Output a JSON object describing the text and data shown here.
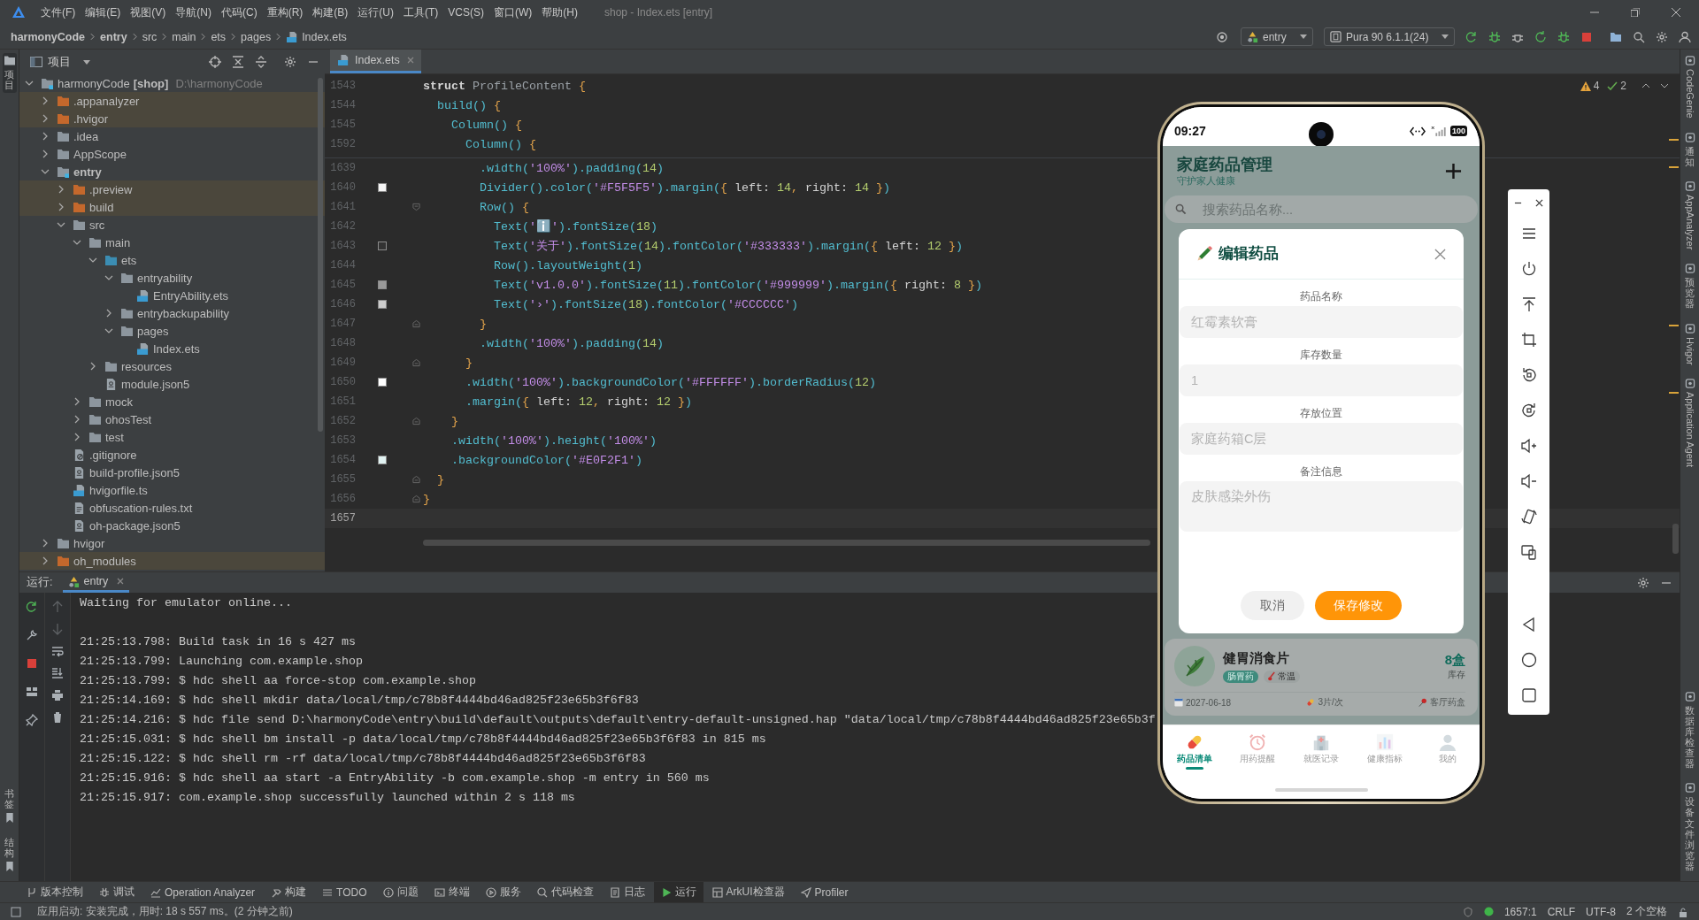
{
  "menu_bar": {
    "items": [
      "文件(F)",
      "编辑(E)",
      "视图(V)",
      "导航(N)",
      "代码(C)",
      "重构(R)",
      "构建(B)",
      "运行(U)",
      "工具(T)",
      "VCS(S)",
      "窗口(W)",
      "帮助(H)"
    ],
    "title": "shop - Index.ets [entry]"
  },
  "nav_bar": {
    "breadcrumb": [
      {
        "label": "harmonyCode",
        "kind": "project"
      },
      {
        "label": "entry",
        "kind": "module"
      },
      {
        "label": "src",
        "kind": "folder"
      },
      {
        "label": "main",
        "kind": "folder"
      },
      {
        "label": "ets",
        "kind": "folder"
      },
      {
        "label": "pages",
        "kind": "folder"
      },
      {
        "label": "Index.ets",
        "kind": "file"
      }
    ],
    "module": "entry",
    "device": "Pura 90 6.1.1(24)"
  },
  "left_strip": {
    "top": [
      {
        "label": "项目",
        "selected": true
      }
    ],
    "bottom": [
      {
        "label": "书签",
        "selected": false
      },
      {
        "label": "结构",
        "selected": false
      }
    ]
  },
  "project_panel": {
    "title": "项目",
    "tree": [
      {
        "label": "harmonyCode",
        "tag": "[shop]",
        "path": "D:\\harmonyCode",
        "kind": "project",
        "expanded": true,
        "children": [
          {
            "label": ".appanalyzer",
            "kind": "excluded",
            "expanded": false
          },
          {
            "label": ".hvigor",
            "kind": "excluded",
            "expanded": false
          },
          {
            "label": ".idea",
            "kind": "folder",
            "expanded": false
          },
          {
            "label": "AppScope",
            "kind": "folder",
            "expanded": false
          },
          {
            "label": "entry",
            "kind": "module",
            "expanded": true,
            "children": [
              {
                "label": ".preview",
                "kind": "excluded",
                "expanded": false
              },
              {
                "label": "build",
                "kind": "excluded",
                "expanded": false
              },
              {
                "label": "src",
                "kind": "folder",
                "expanded": true,
                "children": [
                  {
                    "label": "main",
                    "kind": "folder",
                    "expanded": true,
                    "children": [
                      {
                        "label": "ets",
                        "kind": "source",
                        "expanded": true,
                        "children": [
                          {
                            "label": "entryability",
                            "kind": "folder",
                            "expanded": true,
                            "children": [
                              {
                                "label": "EntryAbility.ets",
                                "kind": "ets"
                              }
                            ]
                          },
                          {
                            "label": "entrybackupability",
                            "kind": "folder",
                            "expanded": false
                          },
                          {
                            "label": "pages",
                            "kind": "folder",
                            "expanded": true,
                            "children": [
                              {
                                "label": "Index.ets",
                                "kind": "ets"
                              }
                            ]
                          }
                        ]
                      },
                      {
                        "label": "resources",
                        "kind": "folder",
                        "expanded": false
                      },
                      {
                        "label": "module.json5",
                        "kind": "json"
                      }
                    ]
                  },
                  {
                    "label": "mock",
                    "kind": "folder",
                    "expanded": false
                  },
                  {
                    "label": "ohosTest",
                    "kind": "folder",
                    "expanded": false
                  },
                  {
                    "label": "test",
                    "kind": "folder",
                    "expanded": false
                  }
                ]
              },
              {
                "label": ".gitignore",
                "kind": "ignore"
              },
              {
                "label": "build-profile.json5",
                "kind": "json"
              },
              {
                "label": "hvigorfile.ts",
                "kind": "ts"
              },
              {
                "label": "obfuscation-rules.txt",
                "kind": "txt"
              },
              {
                "label": "oh-package.json5",
                "kind": "json"
              }
            ]
          },
          {
            "label": "hvigor",
            "kind": "folder",
            "expanded": false
          },
          {
            "label": "oh_modules",
            "kind": "excluded",
            "expanded": false
          }
        ]
      }
    ]
  },
  "editor": {
    "tabs": [
      {
        "label": "Index.ets",
        "selected": true
      }
    ],
    "inspections": {
      "warnings": "4",
      "checks": "2"
    },
    "sticky_lines": [
      {
        "number": "1543",
        "code": "struct ProfileContent {"
      },
      {
        "number": "1544",
        "code": "  build() {"
      },
      {
        "number": "1545",
        "code": "    Column() {"
      },
      {
        "number": "1592",
        "code": "      Column() {"
      }
    ],
    "lines": [
      {
        "number": "1639",
        "code": "        .width('100%').padding(14)",
        "kind": "plain",
        "current": false
      },
      {
        "number": "1640",
        "code": "        Divider().color('#F5F5F5').margin({ left: 14, right: 14 })",
        "color": "#F5F5F5",
        "kind": "plain",
        "current": false
      },
      {
        "number": "1641",
        "code": "        Row() {",
        "kind": "opener",
        "current": false
      },
      {
        "number": "1642",
        "code": "          Text('ℹ️').fontSize(18)",
        "kind": "plain",
        "current": false
      },
      {
        "number": "1643",
        "code": "          Text('关于').fontSize(14).fontColor('#333333').margin({ left: 12 })",
        "color": "#333333",
        "kind": "plain",
        "current": false
      },
      {
        "number": "1644",
        "code": "          Row().layoutWeight(1)",
        "kind": "plain",
        "current": false
      },
      {
        "number": "1645",
        "code": "          Text('v1.0.0').fontSize(11).fontColor('#999999').margin({ right: 8 })",
        "color": "#999999",
        "kind": "plain",
        "current": false
      },
      {
        "number": "1646",
        "code": "          Text('›').fontSize(18).fontColor('#CCCCCC')",
        "color": "#CCCCCC",
        "kind": "plain",
        "current": false
      },
      {
        "number": "1647",
        "code": "        }",
        "kind": "closer",
        "current": false
      },
      {
        "number": "1648",
        "code": "        .width('100%').padding(14)",
        "kind": "plain",
        "current": false
      },
      {
        "number": "1649",
        "code": "      }",
        "kind": "closer",
        "current": false
      },
      {
        "number": "1650",
        "code": "      .width('100%').backgroundColor('#FFFFFF').borderRadius(12)",
        "color": "#FFFFFF",
        "kind": "plain",
        "current": false
      },
      {
        "number": "1651",
        "code": "      .margin({ left: 12, right: 12 })",
        "kind": "plain",
        "current": false
      },
      {
        "number": "1652",
        "code": "    }",
        "kind": "closer",
        "current": false
      },
      {
        "number": "1653",
        "code": "    .width('100%').height('100%')",
        "kind": "plain",
        "current": false
      },
      {
        "number": "1654",
        "code": "    .backgroundColor('#E0F2F1')",
        "color": "#E0F2F1",
        "kind": "plain",
        "current": false
      },
      {
        "number": "1655",
        "code": "  }",
        "kind": "closer",
        "current": false
      },
      {
        "number": "1656",
        "code": "}",
        "kind": "closer",
        "current": false
      },
      {
        "number": "1657",
        "kind": "plain",
        "current": true
      }
    ]
  },
  "right_strip": {
    "top": [
      {
        "label": "CodeGenie",
        "kind": "rotated"
      },
      {
        "label": "通知",
        "kind": "stacked"
      },
      {
        "label": "AppAnalyzer",
        "kind": "rotated"
      },
      {
        "label": "预览器",
        "kind": "stacked"
      },
      {
        "label": "Hvigor",
        "kind": "rotated"
      },
      {
        "label": "Application Agent",
        "kind": "rotated"
      }
    ],
    "bottom": [
      {
        "label": "数据库检查器",
        "kind": "stacked"
      },
      {
        "label": "设备文件浏览器",
        "kind": "stacked"
      }
    ]
  },
  "run_panel": {
    "title": "运行:",
    "tabs": [
      {
        "label": "entry",
        "selected": true
      }
    ],
    "log": [
      [
        "Waiting for emulator online..."
      ],
      [
        "21:25:13.798: Build task in 16 s 427 ms",
        "21:25:13.799: Launching com.example.shop",
        "21:25:13.799: $ hdc shell aa force-stop com.example.shop",
        "21:25:14.169: $ hdc shell mkdir data/local/tmp/c78b8f4444bd46ad825f23e65b3f6f83",
        "21:25:14.216: $ hdc file send D:\\harmonyCode\\entry\\build\\default\\outputs\\default\\entry-default-unsigned.hap \"data/local/tmp/c78b8f4444bd46ad825f23e65b3f",
        "21:25:15.031: $ hdc shell bm install -p data/local/tmp/c78b8f4444bd46ad825f23e65b3f6f83 in 815 ms",
        "21:25:15.122: $ hdc shell rm -rf data/local/tmp/c78b8f4444bd46ad825f23e65b3f6f83",
        "21:25:15.916: $ hdc shell aa start -a EntryAbility -b com.example.shop -m entry in 560 ms",
        "21:25:15.917: com.example.shop successfully launched within 2 s 118 ms"
      ]
    ]
  },
  "tool_windows": [
    {
      "label": "版本控制",
      "kind": "vcs",
      "selected": false
    },
    {
      "label": "调试",
      "kind": "debug",
      "selected": false
    },
    {
      "label": "Operation Analyzer",
      "kind": "analyzer",
      "selected": false
    },
    {
      "label": "构建",
      "kind": "build",
      "selected": false
    },
    {
      "label": "TODO",
      "kind": "todo",
      "selected": false
    },
    {
      "label": "问题",
      "kind": "problems",
      "selected": false
    },
    {
      "label": "终端",
      "kind": "terminal",
      "selected": false
    },
    {
      "label": "服务",
      "kind": "services",
      "selected": false
    },
    {
      "label": "代码检查",
      "kind": "inspect",
      "selected": false
    },
    {
      "label": "日志",
      "kind": "log",
      "selected": false
    },
    {
      "label": "运行",
      "kind": "run",
      "selected": true
    },
    {
      "label": "ArkUI检查器",
      "kind": "inspector",
      "selected": false
    },
    {
      "label": "Profiler",
      "kind": "profiler",
      "selected": false
    }
  ],
  "status_bar": {
    "message": "应用启动: 安装完成，用时: 18 s 557 ms。(2 分钟之前)",
    "position": "1657:1",
    "line_ending": "CRLF",
    "encoding": "UTF-8",
    "indent": "2 个空格"
  },
  "emulator": {
    "status_bar": {
      "time": "09:27",
      "battery": "100"
    },
    "app": {
      "title": "家庭药品管理",
      "subtitle": "守护家人健康",
      "search": {
        "placeholder": "搜索药品名称..."
      },
      "medicines": [
        {
          "name": "健胃消食片",
          "tags": [
            {
              "label": "肠胃药",
              "kind": "category"
            },
            {
              "label": "常温",
              "kind": "storage"
            }
          ],
          "stock": "8盒",
          "stock_label": "库存",
          "expiry": "2027-06-18",
          "dosage": "3片/次",
          "location": "客厅药盒"
        }
      ],
      "tabs": [
        {
          "label": "药品清单",
          "kind": "pill",
          "selected": true
        },
        {
          "label": "用药提醒",
          "kind": "alarm",
          "selected": false
        },
        {
          "label": "就医记录",
          "kind": "hospital",
          "selected": false
        },
        {
          "label": "健康指标",
          "kind": "chart",
          "selected": false
        },
        {
          "label": "我的",
          "kind": "person",
          "selected": false
        }
      ]
    },
    "dialog": {
      "title": "编辑药品",
      "fields": [
        {
          "label": "药品名称",
          "placeholder": "红霉素软膏",
          "kind": "input"
        },
        {
          "label": "库存数量",
          "placeholder": "1",
          "kind": "input"
        },
        {
          "label": "存放位置",
          "placeholder": "家庭药箱C层",
          "kind": "input"
        },
        {
          "label": "备注信息",
          "placeholder": "皮肤感染外伤",
          "kind": "textarea"
        }
      ],
      "buttons": [
        {
          "label": "取消",
          "kind": "secondary"
        },
        {
          "label": "保存修改",
          "kind": "primary"
        }
      ]
    }
  }
}
